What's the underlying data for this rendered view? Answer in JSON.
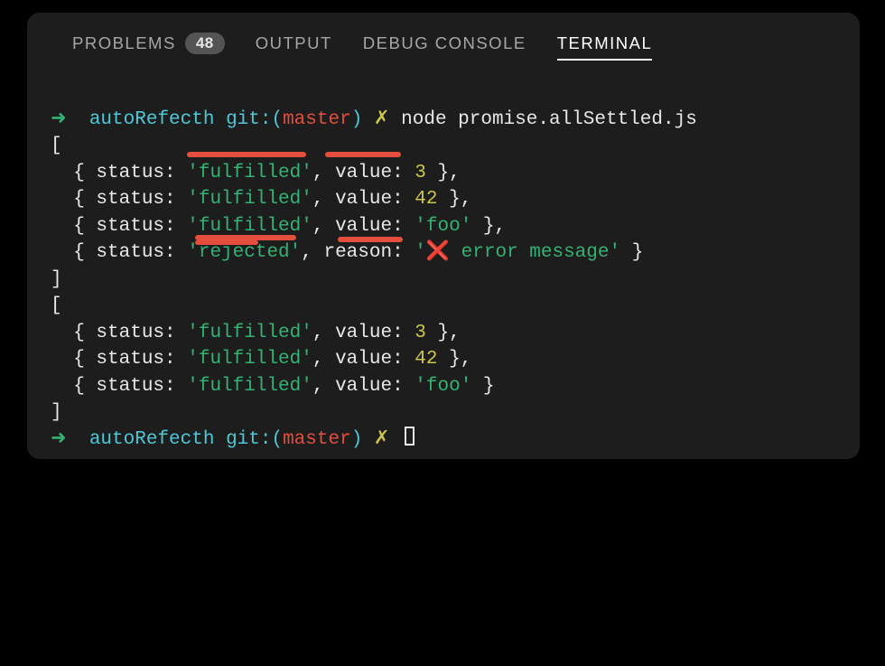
{
  "tabs": {
    "problems": {
      "label": "PROBLEMS",
      "badge": "48"
    },
    "output": {
      "label": "OUTPUT"
    },
    "debug": {
      "label": "DEBUG CONSOLE"
    },
    "terminal": {
      "label": "TERMINAL"
    }
  },
  "prompt": {
    "arrow": "➜",
    "folder": "autoRefecth",
    "git_label": "git:(",
    "branch": "master",
    "git_close": ")",
    "dirty": "✗",
    "command": "node promise.allSettled.js"
  },
  "output": {
    "open1": "[",
    "r1": {
      "pre": "  { status: ",
      "status": "'fulfilled'",
      "mid": ", value: ",
      "val": "3",
      "post": " },"
    },
    "r2": {
      "pre": "  { status: ",
      "status": "'fulfilled'",
      "mid": ", value: ",
      "val": "42",
      "post": " },"
    },
    "r3": {
      "pre": "  { status: ",
      "status": "'fulfilled'",
      "mid": ", value: ",
      "val": "'foo'",
      "post": " },"
    },
    "r4": {
      "pre": "  { status: ",
      "status": "'rejected'",
      "mid": ", reason: ",
      "valq1": "'",
      "emoji": "❌",
      "valtxt": " error message'",
      "post": " }"
    },
    "close1": "]",
    "open2": "[",
    "r5": {
      "pre": "  { status: ",
      "status": "'fulfilled'",
      "mid": ", value: ",
      "val": "3",
      "post": " },"
    },
    "r6": {
      "pre": "  { status: ",
      "status": "'fulfilled'",
      "mid": ", value: ",
      "val": "42",
      "post": " },"
    },
    "r7": {
      "pre": "  { status: ",
      "status": "'fulfilled'",
      "mid": ", value: ",
      "val": "'foo'",
      "post": " }"
    },
    "close2": "]"
  }
}
